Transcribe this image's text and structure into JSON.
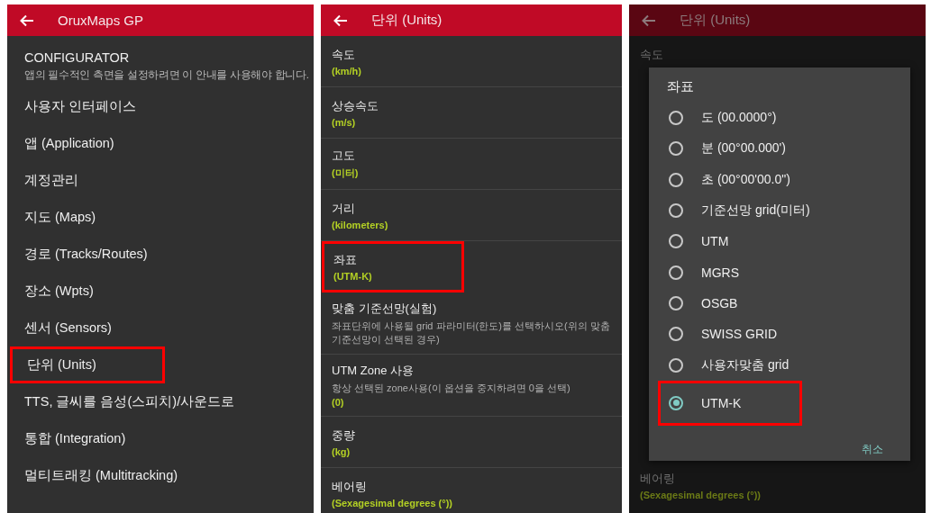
{
  "main_menu": {
    "title": "OruxMaps GP",
    "items": [
      {
        "label": "CONFIGURATOR",
        "description": "앱의 필수적인 측면을 설정하려면 이 안내를 사용해야 합니다.",
        "highlighted": false
      },
      {
        "label": "사용자 인터페이스",
        "highlighted": false
      },
      {
        "label": "앱 (Application)",
        "highlighted": false
      },
      {
        "label": "계정관리",
        "highlighted": false
      },
      {
        "label": "지도 (Maps)",
        "highlighted": false
      },
      {
        "label": "경로 (Tracks/Routes)",
        "highlighted": false
      },
      {
        "label": "장소 (Wpts)",
        "highlighted": false
      },
      {
        "label": "센서 (Sensors)",
        "highlighted": false
      },
      {
        "label": "단위 (Units)",
        "highlighted": true
      },
      {
        "label": "TTS, 글씨를 음성(스피치)/사운드로",
        "highlighted": false
      },
      {
        "label": "통합 (Integration)",
        "highlighted": false
      },
      {
        "label": "멀티트래킹 (Multitracking)",
        "highlighted": false
      }
    ]
  },
  "units_screen": {
    "title": "단위 (Units)",
    "rows": [
      {
        "title": "속도",
        "summary": "(km/h)",
        "highlighted": false
      },
      {
        "title": "상승속도",
        "summary": "(m/s)",
        "highlighted": false
      },
      {
        "title": "고도",
        "summary": "(미터)",
        "highlighted": false
      },
      {
        "title": "거리",
        "summary": "(kilometers)",
        "highlighted": false
      },
      {
        "title": "좌표",
        "summary": "(UTM-K)",
        "highlighted": true
      },
      {
        "title": "맞춤 기준선망(실험)",
        "description": "좌표단위에 사용될 grid 파라미터(한도)를 선택하시오(위의 맞춤 기준선망이 선택된 경우)",
        "highlighted": false
      },
      {
        "title": "UTM  Zone 사용",
        "description": "항상 선택된 zone사용(이 옵션을 중지하려면 0을 선택)",
        "summary": "(0)",
        "highlighted": false
      },
      {
        "title": "중량",
        "summary": "(kg)",
        "highlighted": false
      },
      {
        "title": "베어링",
        "summary": "(Sexagesimal degrees (°))",
        "highlighted": false
      }
    ]
  },
  "dialog_screen": {
    "title": "단위 (Units)",
    "background_rows": [
      {
        "title": "속도"
      },
      {
        "title": "베어링",
        "summary": "(Sexagesimal degrees (°))"
      }
    ],
    "dialog": {
      "title": "좌표",
      "options": [
        {
          "label": "도 (00.0000°)",
          "selected": false,
          "highlighted": false
        },
        {
          "label": "분 (00°00.000')",
          "selected": false,
          "highlighted": false
        },
        {
          "label": "초 (00°00'00.0\")",
          "selected": false,
          "highlighted": false
        },
        {
          "label": "기준선망 grid(미터)",
          "selected": false,
          "highlighted": false
        },
        {
          "label": "UTM",
          "selected": false,
          "highlighted": false
        },
        {
          "label": "MGRS",
          "selected": false,
          "highlighted": false
        },
        {
          "label": "OSGB",
          "selected": false,
          "highlighted": false
        },
        {
          "label": "SWISS GRID",
          "selected": false,
          "highlighted": false
        },
        {
          "label": "사용자맞춤 grid",
          "selected": false,
          "highlighted": false
        },
        {
          "label": "UTM-K",
          "selected": true,
          "highlighted": true
        }
      ],
      "cancel_button": "취소"
    }
  }
}
